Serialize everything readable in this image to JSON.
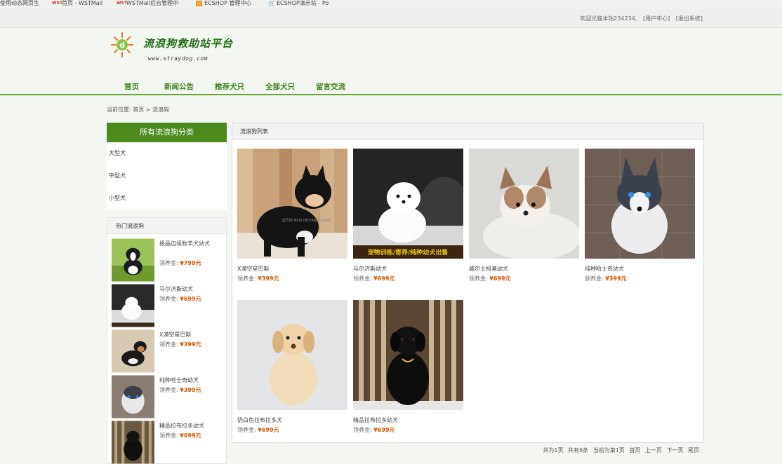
{
  "bookmarks": [
    {
      "label": "使用动态网页生",
      "icon": "page-icon"
    },
    {
      "label": "首页 - WSTMall",
      "icon": "wst-icon"
    },
    {
      "label": "WSTMall后台管理中",
      "icon": "wst-icon"
    },
    {
      "label": "ECSHOP 管理中心",
      "icon": "box-icon"
    },
    {
      "label": "ECSHOP演示站 - Po",
      "icon": "cart-icon"
    }
  ],
  "topbar": {
    "welcome": "欢迎光临本站234234,",
    "user_center": "[用户中心]",
    "logout": "[退出系统]"
  },
  "header": {
    "site_title": "流浪狗救助站平台",
    "site_url": "www.straydog.com"
  },
  "nav": {
    "items": [
      "首页",
      "新闻公告",
      "推荐犬只",
      "全部犬只",
      "留言交流"
    ]
  },
  "breadcrumb": "当前位置: 首页 > 流浪狗",
  "sidebar": {
    "title": "所有流浪狗分类",
    "categories": [
      "大型犬",
      "中型犬",
      "小型犬"
    ],
    "hot_title": "热门流浪狗",
    "hot_items": [
      {
        "name": "极品边境牧羊犬幼犬",
        "price_label": "领养金:",
        "price": "¥799元"
      },
      {
        "name": "马尔济斯幼犬",
        "price_label": "领养金:",
        "price": "¥699元"
      },
      {
        "name": "X漠空星巴斯",
        "price_label": "领养金:",
        "price": "¥399元"
      },
      {
        "name": "纯种哈士奇幼犬",
        "price_label": "领养金:",
        "price": "¥399元"
      },
      {
        "name": "精品拉布拉多幼犬",
        "price_label": "领养金:",
        "price": "¥699元"
      }
    ]
  },
  "main": {
    "title": "流浪狗列表",
    "dogs": [
      {
        "name": "X漠空星巴斯",
        "price_label": "领养金:",
        "price": "¥399元",
        "image_caption": "星巴斯 NEW INTERNATIONAL"
      },
      {
        "name": "马尔济斯幼犬",
        "price_label": "领养金:",
        "price": "¥699元",
        "image_caption": "宠物训练/寄养/纯种幼犬出售"
      },
      {
        "name": "威尔士柯基幼犬",
        "price_label": "领养金:",
        "price": "¥699元",
        "image_caption": ""
      },
      {
        "name": "纯种哈士奇幼犬",
        "price_label": "领养金:",
        "price": "¥399元",
        "image_caption": ""
      },
      {
        "name": "奶白色拉布拉多犬",
        "price_label": "领养金:",
        "price": "¥699元",
        "image_caption": ""
      },
      {
        "name": "精品拉布拉多幼犬",
        "price_label": "领养金:",
        "price": "¥699元",
        "image_caption": ""
      }
    ]
  },
  "pagination": {
    "total_pages": "共为1页",
    "total_items": "共有6条",
    "current": "当前为第1页",
    "first": "首页",
    "prev": "上一页",
    "next": "下一页",
    "last": "尾页"
  },
  "colors": {
    "accent": "#4c8a1c",
    "nav_text": "#3d7f1d",
    "price": "#d35400",
    "nav_line": "#6aa836"
  }
}
